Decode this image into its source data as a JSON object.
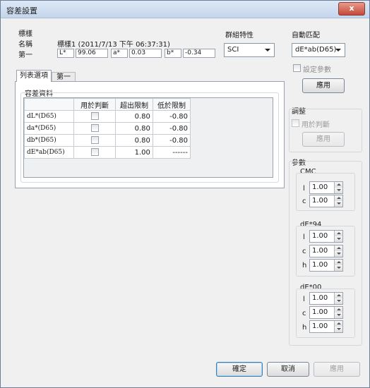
{
  "window": {
    "title": "容差設置",
    "close_glyph": "x"
  },
  "standard": {
    "group_label": "標樣",
    "name_label": "名稱",
    "name_value": "標樣1 (2011/7/13 下午 06:37:31)",
    "first_label": "第一",
    "l_prefix": "L*",
    "l_value": "99.06",
    "a_prefix": "a*",
    "a_value": "0.03",
    "b_prefix": "b*",
    "b_value": "-0.34"
  },
  "group_characteristic": {
    "label": "群組特性",
    "selected": "SCI"
  },
  "auto_match": {
    "label": "自動匹配",
    "selected": "dE*ab(D65)",
    "set_params_label": "設定參數",
    "apply_label": "應用"
  },
  "adjust": {
    "label": "調整",
    "use_for_judge_label": "用於判斷",
    "apply_label": "應用"
  },
  "tabs": [
    {
      "label": "列表選項"
    },
    {
      "label": "第一"
    }
  ],
  "tolerance": {
    "group_label": "容差資料",
    "columns": [
      "",
      "用於判斷",
      "超出限制",
      "低於限制"
    ],
    "rows": [
      {
        "name": "dL*(D65)",
        "upper": "0.80",
        "lower": "-0.80"
      },
      {
        "name": "da*(D65)",
        "upper": "0.80",
        "lower": "-0.80"
      },
      {
        "name": "db*(D65)",
        "upper": "0.80",
        "lower": "-0.80"
      },
      {
        "name": "dE*ab(D65)",
        "upper": "1.00",
        "lower": "------"
      }
    ]
  },
  "params": {
    "label": "參數",
    "cmc": {
      "label": "CMC",
      "l_label": "l",
      "l_value": "1.00",
      "c_label": "c",
      "c_value": "1.00"
    },
    "de94": {
      "label": "dE*94",
      "l_label": "l",
      "l_value": "1.00",
      "c_label": "c",
      "c_value": "1.00",
      "h_label": "h",
      "h_value": "1.00"
    },
    "de00": {
      "label": "dE*00",
      "l_label": "l",
      "l_value": "1.00",
      "c_label": "c",
      "c_value": "1.00",
      "h_label": "h",
      "h_value": "1.00"
    }
  },
  "footer": {
    "ok_label": "確定",
    "cancel_label": "取消",
    "apply_label": "應用"
  }
}
